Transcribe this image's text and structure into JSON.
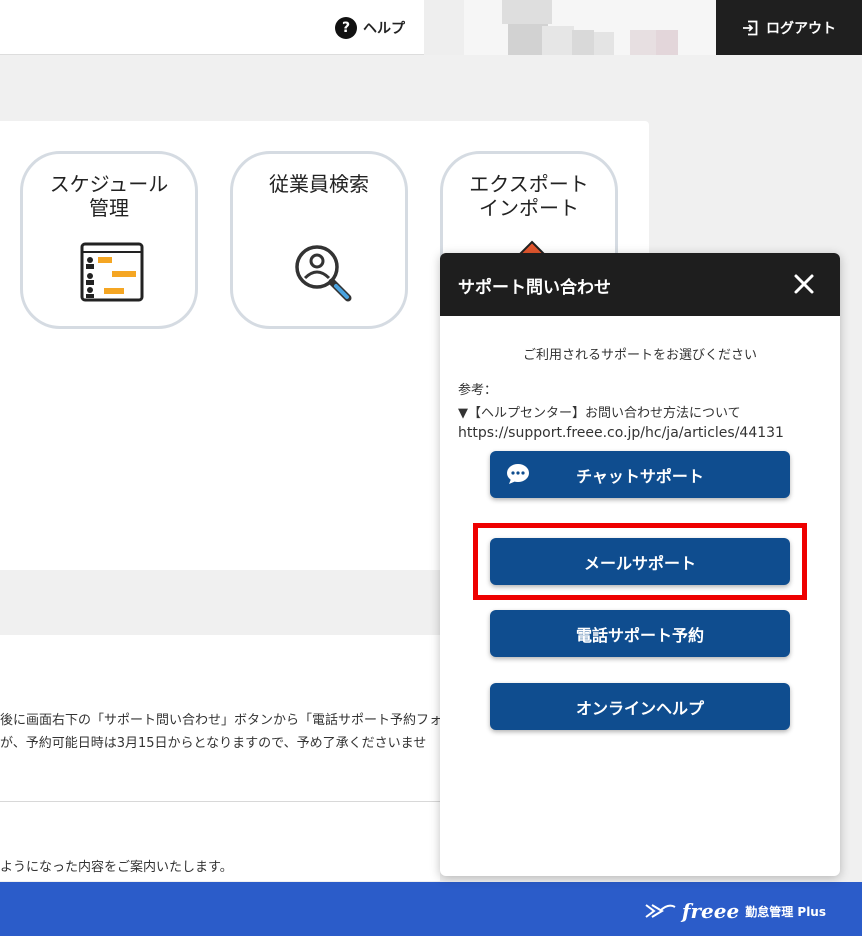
{
  "header": {
    "help_label": "ヘルプ",
    "help_icon": "?",
    "logout_label": "ログアウト"
  },
  "menu": {
    "tiles": [
      {
        "label": "スケジュール\n管理",
        "icon": "schedule-icon"
      },
      {
        "label": "従業員検索",
        "icon": "employee-search-icon"
      },
      {
        "label": "エクスポート\nインポート",
        "icon": "export-import-icon"
      }
    ]
  },
  "info": {
    "line1": "後に画面右下の「サポート問い合わせ」ボタンから「電話サポート予約フォ",
    "line2": "が、予約可能日時は3月15日からとなりますので、予め了承くださいませ",
    "line3": "ようになった内容をご案内いたします。"
  },
  "support": {
    "title": "サポート問い合わせ",
    "prompt": "ご利用されるサポートをお選びください",
    "ref_label": "参考：",
    "ref_title": "▼【ヘルプセンター】お問い合わせ方法について",
    "ref_url": "https://support.freee.co.jp/hc/ja/articles/44131",
    "buttons": {
      "chat": "チャットサポート",
      "mail": "メールサポート",
      "phone": "電話サポート予約",
      "online": "オンラインヘルプ"
    }
  },
  "footer": {
    "brand_logo": "freee",
    "brand_name": "勤怠管理 Plus"
  },
  "colors": {
    "button": "#0f4d8f",
    "footer": "#2b5cc9",
    "highlight": "#ee0000",
    "panel_header": "#1e1e1e"
  }
}
